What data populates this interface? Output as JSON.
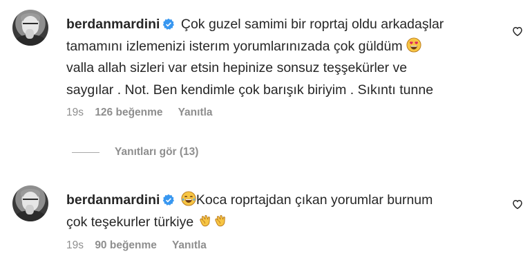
{
  "comments": [
    {
      "username": "berdanmardini",
      "verified": true,
      "lines": [
        "Çok guzel samimi bir roprtaj oldu arkadaşlar",
        "tamamını izlemenizi isterım yorumlarınızada çok güldüm",
        "valla allah sizleri var etsin hepinize sonsuz teşşekürler ve",
        "saygılar . Not. Ben kendimle çok barışık biriyim . Sıkıntı tunne"
      ],
      "emoji_after_line_2": "heart-eyes-emoji",
      "time": "19s",
      "likes": "126 beğenme",
      "reply": "Yanıtla"
    },
    {
      "username": "berdanmardini",
      "verified": true,
      "lead_emoji": "tears-of-joy-emoji",
      "lines": [
        "Koca roprtajdan çıkan yorumlar burnum",
        "çok teşekurler türkiye"
      ],
      "trailing_emojis": [
        "clapping-hands-emoji",
        "clapping-hands-emoji"
      ],
      "time": "19s",
      "likes": "90 beğenme",
      "reply": "Yanıtla"
    }
  ],
  "view_replies": "Yanıtları gör (13)",
  "colors": {
    "text": "#262626",
    "muted": "#8e8e8e",
    "verified": "#3897f0",
    "emoji_yellow": "#f7c544"
  }
}
